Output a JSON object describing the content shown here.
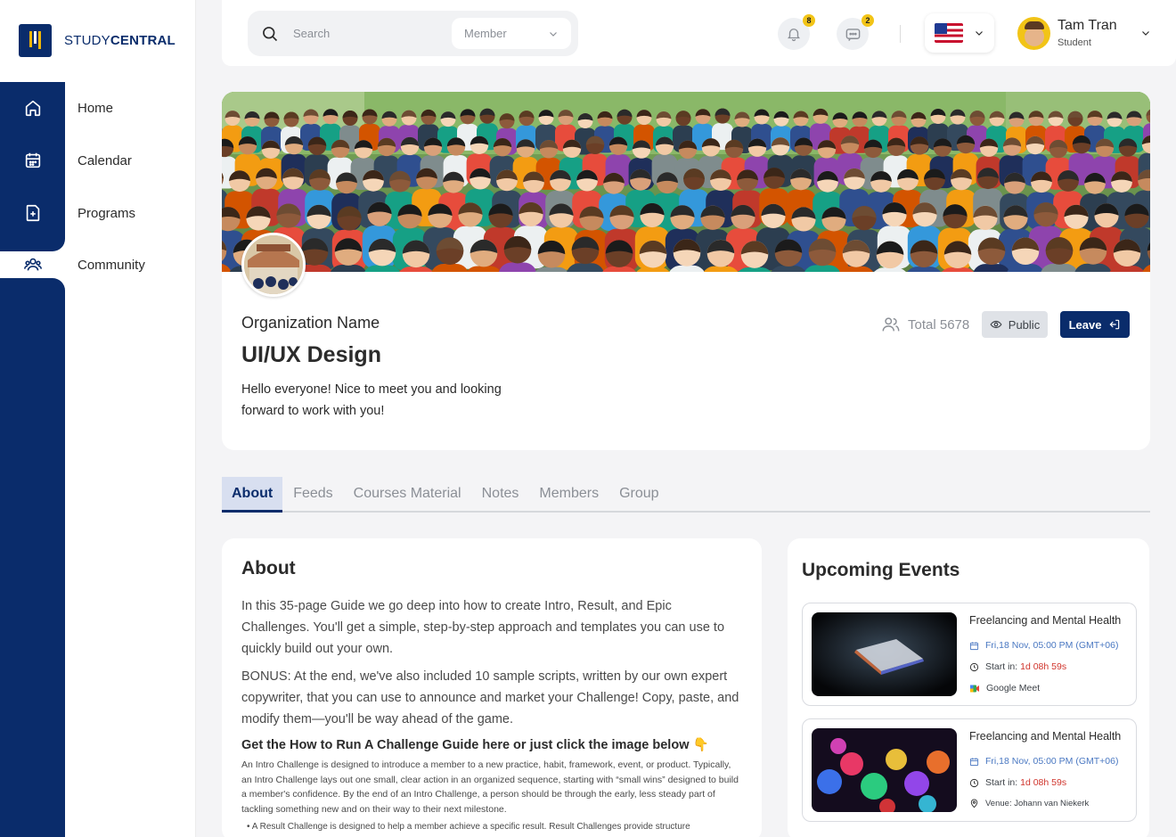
{
  "brand": {
    "name_light": "STUDY",
    "name_bold": "CENTRAL"
  },
  "sidebar": {
    "items": [
      {
        "label": "Home",
        "icon": "home-icon"
      },
      {
        "label": "Calendar",
        "icon": "calendar-icon"
      },
      {
        "label": "Programs",
        "icon": "programs-icon"
      },
      {
        "label": "Community",
        "icon": "community-icon",
        "active": true
      }
    ]
  },
  "topbar": {
    "search_placeholder": "Search",
    "search_filter": "Member",
    "notifications_count": "8",
    "messages_count": "2",
    "language_flag": "us-flag",
    "user": {
      "name": "Tam Tran",
      "role": "Student"
    }
  },
  "profile": {
    "org_label": "Organization Name",
    "title": "UI/UX Design",
    "description": "Hello everyone! Nice to meet you and looking forward to work with you!",
    "total_label": "Total 5678",
    "visibility": "Public",
    "leave_label": "Leave"
  },
  "tabs": [
    "About",
    "Feeds",
    "Courses Material",
    "Notes",
    "Members",
    "Group"
  ],
  "about": {
    "heading": "About",
    "p1": "In this 35-page Guide we go deep into how to create Intro, Result, and Epic Challenges. You'll get a simple, step-by-step approach and templates you can use to quickly build out your own.",
    "p2": "BONUS: At the end, we've also included 10 sample scripts, written by our own expert copywriter, that you can use to announce and market your Challenge! Copy, paste, and modify them—you'll be way ahead of the game.",
    "h3": "Get the How to Run A Challenge Guide here or just click the image below 👇",
    "p3": "An Intro Challenge is designed to introduce a member to a new practice, habit, framework, event, or product. Typically, an Intro Challenge lays out one small, clear action in an organized sequence, starting with “small wins” designed to build a member's confidence. By the end of an Intro Challenge, a person should be through the early, less steady part of tackling something new and on their way to their next milestone.",
    "p4": "• A Result Challenge is designed to help a member achieve a specific result. Result Challenges provide structure"
  },
  "events": {
    "heading": "Upcoming Events",
    "items": [
      {
        "title": "Freelancing and Mental Health",
        "date": "Fri,18 Nov, 05:00 PM (GMT+06)",
        "start_label": "Start in:",
        "start_value": "1d 08h 59s",
        "location": "Google Meet"
      },
      {
        "title": "Freelancing and Mental Health",
        "date": "Fri,18 Nov, 05:00 PM (GMT+06)",
        "start_label": "Start in:",
        "start_value": "1d 08h 59s",
        "location": "Venue: Johann van Niekerk"
      }
    ]
  },
  "colors": {
    "primary": "#0a2c6b",
    "accent": "#f2c417",
    "danger": "#d0342c",
    "link": "#4a78c2"
  }
}
